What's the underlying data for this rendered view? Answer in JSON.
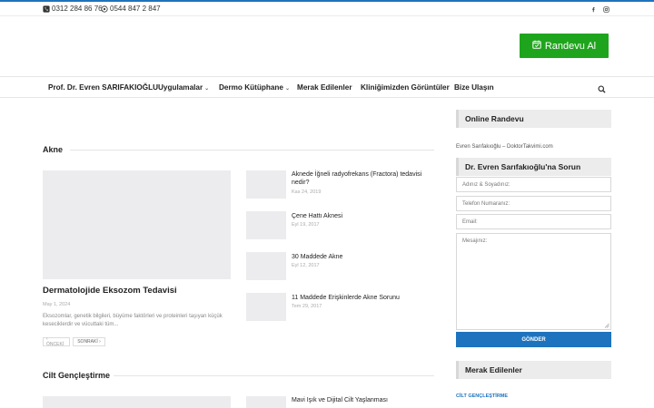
{
  "topbar": {
    "phone1": "0312 284 86 76",
    "phone2": "0544 847 2 847",
    "phone1_icon": "phone-icon",
    "phone2_icon": "whatsapp-icon",
    "social": [
      "facebook-icon",
      "instagram-icon"
    ]
  },
  "header": {
    "appointment_label": "Randevu Al",
    "appointment_icon": "calendar-check-icon"
  },
  "nav": {
    "items": [
      {
        "label": "Prof. Dr. Evren SARIFAKIOĞLU",
        "dropdown": false
      },
      {
        "label": "Uygulamalar",
        "dropdown": true
      },
      {
        "label": "Dermo Kütüphane",
        "dropdown": true
      },
      {
        "label": "Merak Edilenler",
        "dropdown": false
      },
      {
        "label": "Kliniğimizden Görüntüler",
        "dropdown": false
      },
      {
        "label": "Bize Ulaşın",
        "dropdown": false
      }
    ],
    "search_icon": "search-icon"
  },
  "main": {
    "sections": [
      {
        "title": "Akne",
        "featured": {
          "title": "Dermatolojide Eksozom Tedavisi",
          "date": "May 1, 2024",
          "excerpt": "Eksozomlar, genetik bilgileri, büyüme faktörleri ve proteinleri taşıyan küçük keseciklerdir ve vücuttaki tüm..."
        },
        "posts": [
          {
            "title": "Aknede İğneli radyofrekans (Fractora) tedavisi nedir?",
            "date": "Kas 24, 2019"
          },
          {
            "title": "Çene Hattı Aknesi",
            "date": "Eyl 19, 2017"
          },
          {
            "title": "30 Maddede Akne",
            "date": "Eyl 12, 2017"
          },
          {
            "title": "11 Maddede Erişkinlerde Akne Sorunu",
            "date": "Tem 29, 2017"
          }
        ],
        "pager": {
          "prev": "‹ ÖNCEKİ",
          "next": "SONRAKİ ›"
        }
      },
      {
        "title": "Cilt Gençleştirme",
        "posts": [
          {
            "title": "Mavi Işık ve Dijital Cilt Yaşlanması"
          }
        ]
      }
    ]
  },
  "sidebar": {
    "online_title": "Online Randevu",
    "online_link": "Evren Sarıfakıoğlu – DoktorTakvimi.com",
    "ask_title": "Dr. Evren Sarıfakıoğlu'na Sorun",
    "form": {
      "name_placeholder": "Adınız & Soyadınız:",
      "phone_placeholder": "Telefon Numaranız:",
      "email_placeholder": "Email:",
      "message_placeholder": "Mesajınız:",
      "submit_label": "GÖNDER"
    },
    "faq_title": "Merak Edilenler",
    "faq_category": "CİLT GENÇLEŞTİRME"
  },
  "colors": {
    "accent": "#1e73be",
    "appointment_green": "#1fa51d",
    "placeholder_gray": "#ececee"
  }
}
